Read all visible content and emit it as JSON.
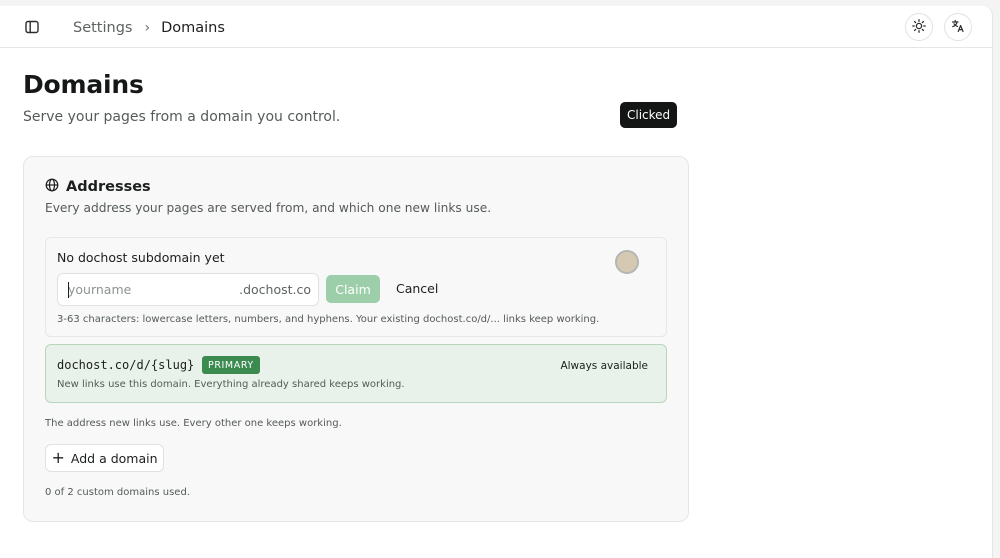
{
  "header": {
    "breadcrumb_parent": "Settings",
    "breadcrumb_separator": "›",
    "breadcrumb_current": "Domains",
    "icons": [
      "sidebar-toggle-icon",
      "sun-icon",
      "translate-icon"
    ]
  },
  "page": {
    "title": "Domains",
    "subtitle": "Serve your pages from a domain you control."
  },
  "addresses": {
    "title": "Addresses",
    "icon": "globe-icon",
    "description": "Every address your pages are served from, and which one new links use.",
    "claim": {
      "title": "No dochost subdomain yet",
      "input_value": "",
      "input_placeholder": "yourname",
      "suffix": ".dochost.co",
      "claim_label": "Claim",
      "cancel_label": "Cancel",
      "help": "3-63 characters: lowercase letters, numbers, and hyphens. Your existing dochost.co/d/... links keep working."
    },
    "primary": {
      "domain": "dochost.co/d/{slug}",
      "badge": "PRIMARY",
      "note": "New links use this domain. Everything already shared keeps working.",
      "status": "Always available"
    },
    "address_note": "The address new links use. Every other one keeps working.",
    "add_domain_label": "Add a domain",
    "usage": "0 of 2 custom domains used."
  },
  "tooltip": {
    "label": "Clicked"
  },
  "colors": {
    "accent": "#3b8a50",
    "claim_disabled": "#9ccfa9",
    "primary_bg": "#e8f2ea",
    "tooltip_bg": "#131614"
  }
}
